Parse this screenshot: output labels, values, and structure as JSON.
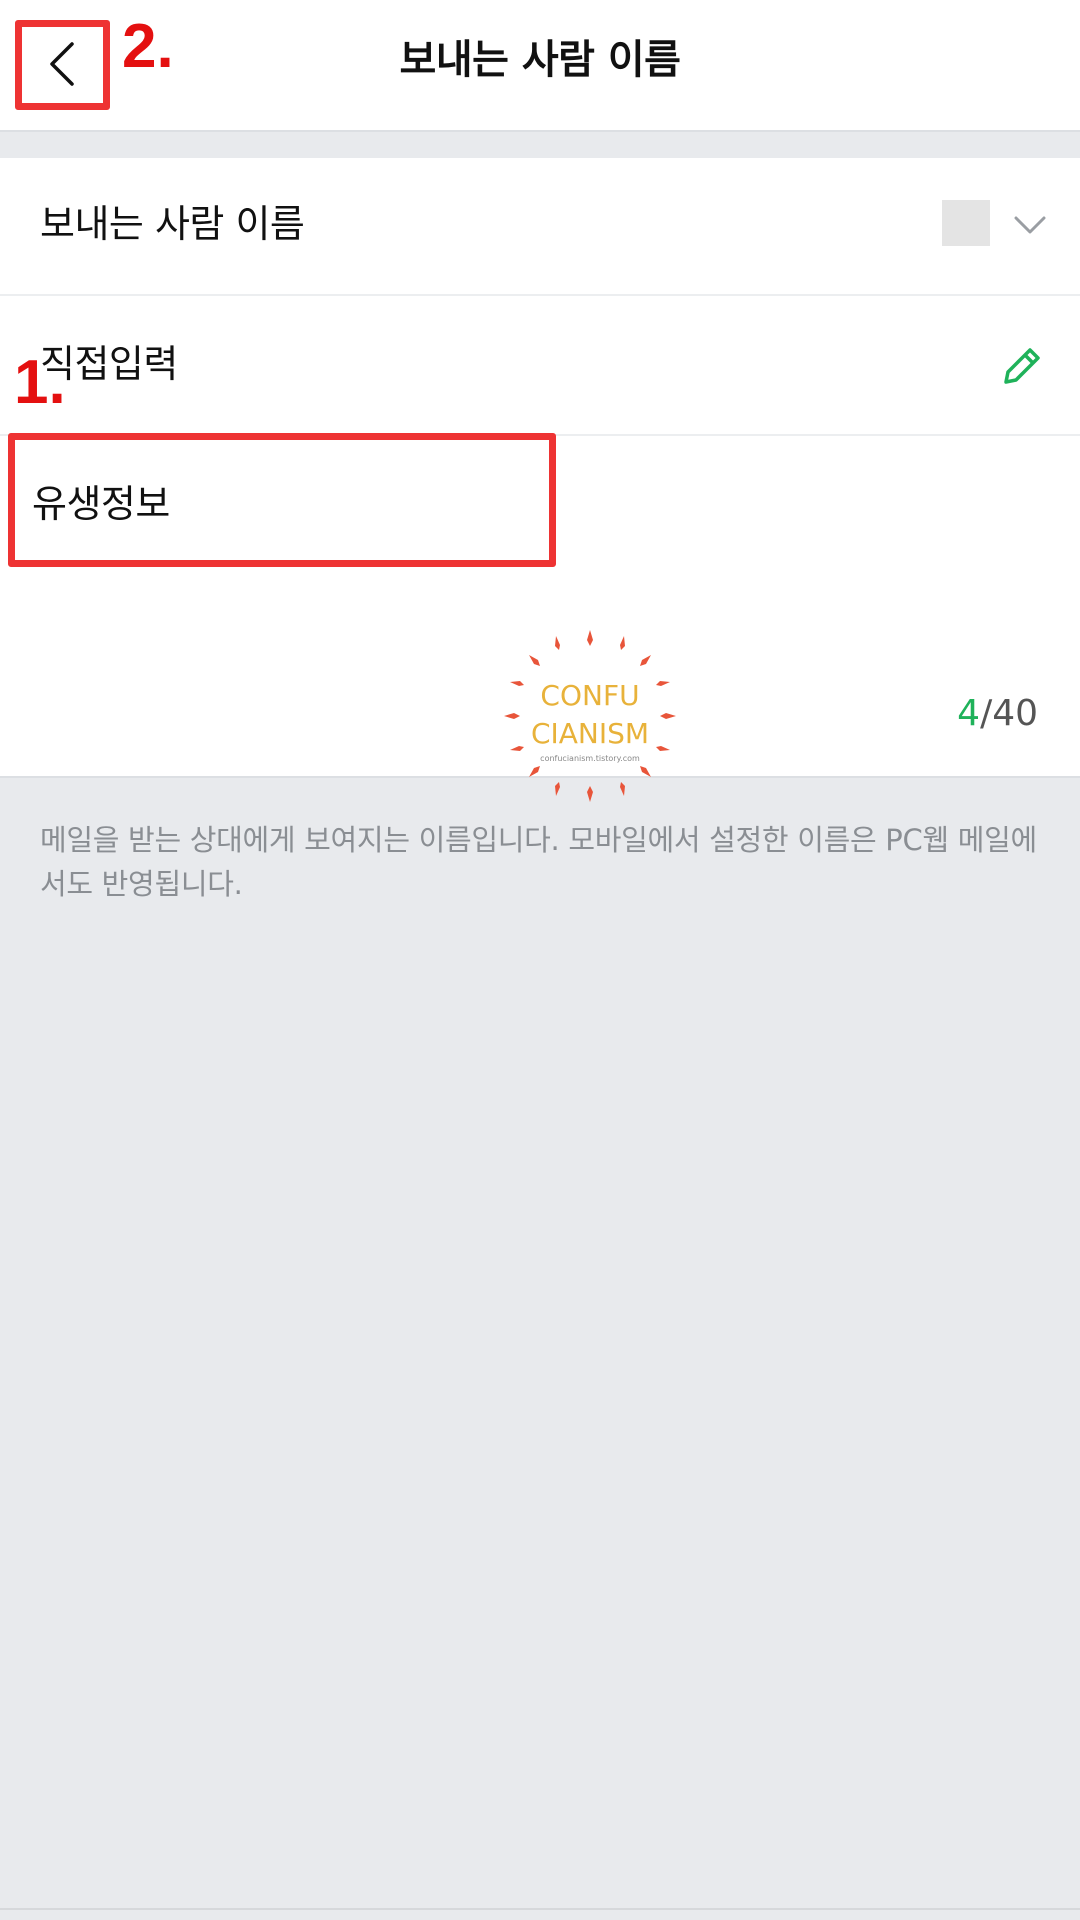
{
  "header": {
    "title": "보내는 사람 이름",
    "back_icon": "chevron-left-icon"
  },
  "settings": {
    "sender_name_row": {
      "label": "보내는 사람 이름",
      "dropdown_icon": "chevron-down-icon"
    },
    "direct_input_row": {
      "label": "직접입력",
      "edit_icon": "pencil-icon"
    },
    "name_field": {
      "value": "유생정보",
      "counter_current": "4",
      "counter_max": "/40"
    }
  },
  "help_text": "메일을 받는 상대에게 보여지는 이름입니다. 모바일에서 설정한 이름은 PC웹 메일에서도 반영됩니다.",
  "watermark": {
    "line1": "CONFU",
    "line2": "CIANISM",
    "url": "confucianism.tistory.com"
  },
  "annotations": {
    "label_1": "1.",
    "label_2": "2."
  },
  "colors": {
    "accent_green": "#1fb25a",
    "annotation_red": "#ee3333",
    "background_gray": "#e8eaed"
  }
}
